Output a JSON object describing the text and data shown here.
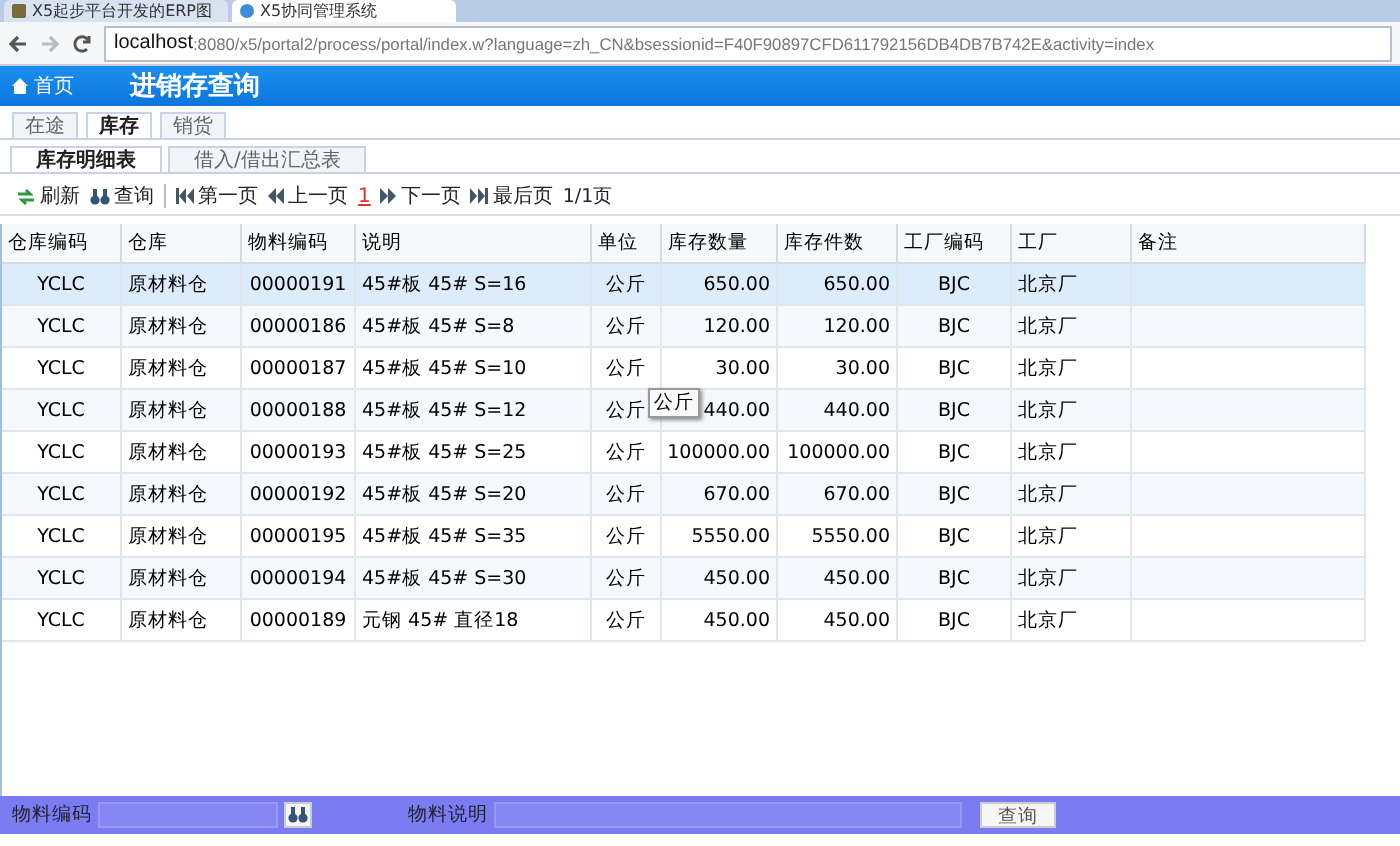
{
  "browser": {
    "tabs": [
      {
        "label": "X5起步平台开发的ERP图",
        "selected": false
      },
      {
        "label": "X5协同管理系统",
        "selected": true
      }
    ],
    "url_host": "localhost",
    "url_rest": ":8080/x5/portal2/process/portal/index.w?language=zh_CN&bsessionid=F40F90897CFD611792156DB4DB7B742E&activity=index"
  },
  "header": {
    "home": "首页",
    "title": "进销存查询"
  },
  "tabs": [
    {
      "label": "在途",
      "selected": false
    },
    {
      "label": "库存",
      "selected": true
    },
    {
      "label": "销货",
      "selected": false
    }
  ],
  "subtabs": [
    {
      "label": "库存明细表",
      "selected": true
    },
    {
      "label": "借入/借出汇总表",
      "selected": false
    }
  ],
  "toolbar": [
    {
      "kind": "refresh",
      "label": "刷新"
    },
    {
      "kind": "search",
      "label": "查询"
    },
    {
      "kind": "sep"
    },
    {
      "kind": "first",
      "label": "第一页"
    },
    {
      "kind": "prev",
      "label": "上一页"
    },
    {
      "kind": "page",
      "label": "1"
    },
    {
      "kind": "next",
      "label": "下一页"
    },
    {
      "kind": "last",
      "label": "最后页"
    },
    {
      "kind": "text",
      "label": "1/1页"
    }
  ],
  "table": {
    "columns": [
      "仓库编码",
      "仓库",
      "物料编码",
      "说明",
      "单位",
      "库存数量",
      "库存件数",
      "工厂编码",
      "工厂",
      "备注"
    ],
    "rows": [
      {
        "selected": true,
        "cells": [
          "YCLC",
          "原材料仓",
          "00000191",
          "45#板 45# S=16",
          "公斤",
          "650.00",
          "650.00",
          "BJC",
          "北京厂",
          ""
        ]
      },
      {
        "selected": false,
        "cells": [
          "YCLC",
          "原材料仓",
          "00000186",
          "45#板 45# S=8",
          "公斤",
          "120.00",
          "120.00",
          "BJC",
          "北京厂",
          ""
        ]
      },
      {
        "selected": false,
        "cells": [
          "YCLC",
          "原材料仓",
          "00000187",
          "45#板 45# S=10",
          "公斤",
          "30.00",
          "30.00",
          "BJC",
          "北京厂",
          ""
        ]
      },
      {
        "selected": false,
        "cells": [
          "YCLC",
          "原材料仓",
          "00000188",
          "45#板 45# S=12",
          "公斤",
          "440.00",
          "440.00",
          "BJC",
          "北京厂",
          ""
        ]
      },
      {
        "selected": false,
        "cells": [
          "YCLC",
          "原材料仓",
          "00000193",
          "45#板 45# S=25",
          "公斤",
          "100000.00",
          "100000.00",
          "BJC",
          "北京厂",
          ""
        ]
      },
      {
        "selected": false,
        "cells": [
          "YCLC",
          "原材料仓",
          "00000192",
          "45#板 45# S=20",
          "公斤",
          "670.00",
          "670.00",
          "BJC",
          "北京厂",
          ""
        ]
      },
      {
        "selected": false,
        "cells": [
          "YCLC",
          "原材料仓",
          "00000195",
          "45#板 45# S=35",
          "公斤",
          "5550.00",
          "5550.00",
          "BJC",
          "北京厂",
          ""
        ]
      },
      {
        "selected": false,
        "cells": [
          "YCLC",
          "原材料仓",
          "00000194",
          "45#板 45# S=30",
          "公斤",
          "450.00",
          "450.00",
          "BJC",
          "北京厂",
          ""
        ]
      },
      {
        "selected": false,
        "cells": [
          "YCLC",
          "原材料仓",
          "00000189",
          "元钢 45# 直径18",
          "公斤",
          "450.00",
          "450.00",
          "BJC",
          "北京厂",
          ""
        ]
      }
    ]
  },
  "tooltip": "公斤",
  "filter": {
    "code_label": "物料编码",
    "desc_label": "物料说明",
    "button": "查询"
  }
}
